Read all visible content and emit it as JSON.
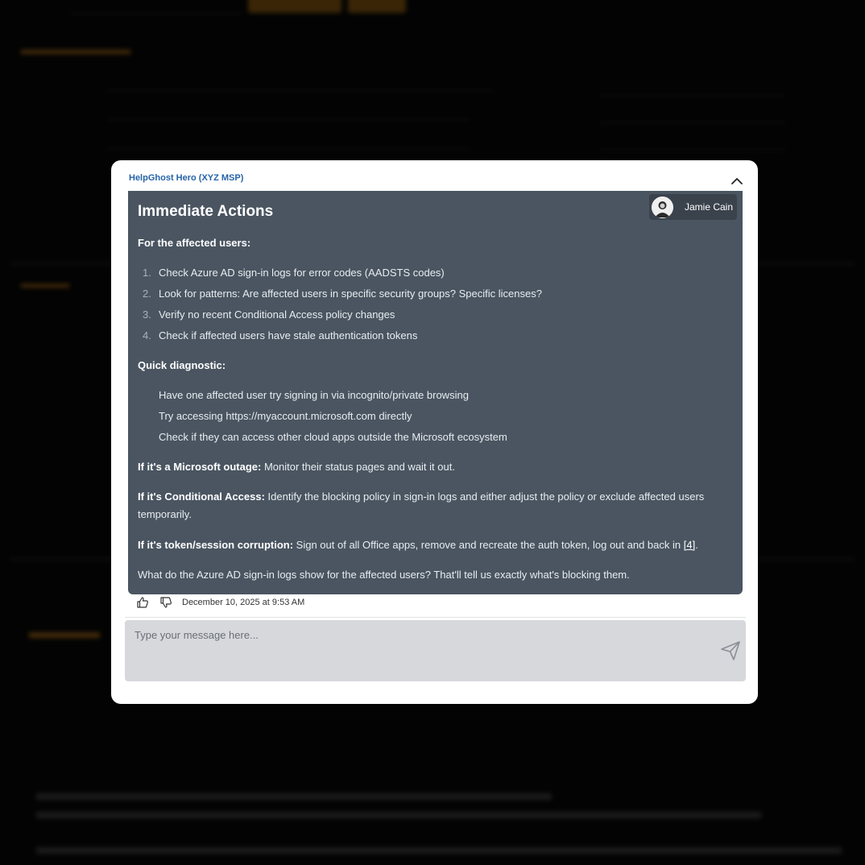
{
  "chat": {
    "title": "HelpGhost Hero (XYZ MSP)",
    "agent_name": "Jamie Cain",
    "heading": "Immediate Actions",
    "affected_label": "For the affected users:",
    "actions": [
      {
        "n": "1.",
        "text": "Check Azure AD sign-in logs for error codes (AADSTS codes)"
      },
      {
        "n": "2.",
        "text": "Look for patterns: Are affected users in specific security groups? Specific licenses?"
      },
      {
        "n": "3.",
        "text": "Verify no recent Conditional Access policy changes"
      },
      {
        "n": "4.",
        "text": "Check if affected users have stale authentication tokens"
      }
    ],
    "quick_label": "Quick diagnostic:",
    "quick_items": [
      "Have one affected user try signing in via incognito/private browsing",
      "Try accessing https://myaccount.microsoft.com directly",
      "Check if they can access other cloud apps outside the Microsoft ecosystem"
    ],
    "outage_label": "If it's a Microsoft outage:",
    "outage_text": " Monitor their status pages and wait it out.",
    "ca_label": "If it's Conditional Access:",
    "ca_text": " Identify the blocking policy in sign-in logs and either adjust the policy or exclude affected users temporarily.",
    "token_label": "If it's token/session corruption:",
    "token_text": " Sign out of all Office apps, remove and recreate the auth token, log out and back in ",
    "token_ref": "[4]",
    "token_end": ".",
    "closing": "What do the Azure AD sign-in logs show for the affected users? That'll tell us exactly what's blocking them.",
    "timestamp": "December 10, 2025 at 9:53 AM",
    "input_placeholder": "Type your message here..."
  },
  "icons": {
    "collapse": "chevron-up-icon",
    "like": "thumbs-up-icon",
    "dislike": "thumbs-down-icon",
    "send": "send-icon"
  },
  "colors": {
    "message_bg": "#4a5561",
    "title_blue": "#2563a8",
    "composer_bg": "#d6d8dc"
  }
}
